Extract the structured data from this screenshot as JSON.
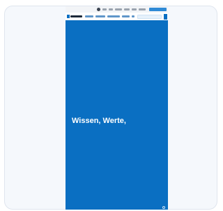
{
  "page": {
    "hero": {
      "headline": "Wissen, Werte,"
    },
    "colors": {
      "hero_background": "#0a6fc2",
      "card_background": "#f5f8fc",
      "card_border": "#dfe5ee",
      "headline_text": "#ffffff"
    },
    "icons": {
      "logo": "brand-logo-icon",
      "menu": "menu-icon",
      "search": "search-icon",
      "corner": "circle-icon"
    }
  }
}
